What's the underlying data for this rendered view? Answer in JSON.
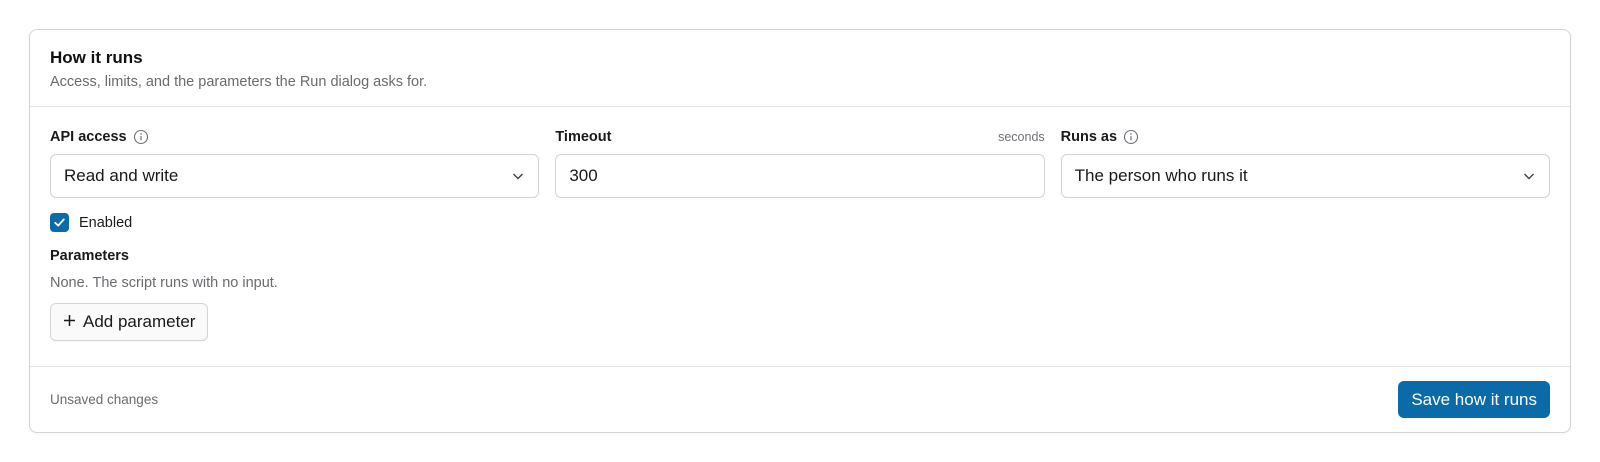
{
  "section": {
    "title": "How it runs",
    "subtitle": "Access, limits, and the parameters the Run dialog asks for."
  },
  "fields": {
    "api_access": {
      "label": "API access",
      "icon": "info-icon",
      "value": "Read and write"
    },
    "timeout": {
      "label": "Timeout",
      "suffix": "seconds",
      "value": "300"
    },
    "runs_as": {
      "label": "Runs as",
      "icon": "info-icon",
      "value": "The person who runs it"
    }
  },
  "enabled": {
    "label": "Enabled",
    "checked": true
  },
  "parameters": {
    "title": "Parameters",
    "empty_text": "None. The script runs with no input.",
    "add_label": "Add parameter"
  },
  "footer": {
    "status": "Unsaved changes",
    "save_label": "Save how it runs"
  },
  "colors": {
    "accent": "#0b6aa8",
    "border": "#d4d4d8",
    "muted_text": "#6b6b70"
  }
}
